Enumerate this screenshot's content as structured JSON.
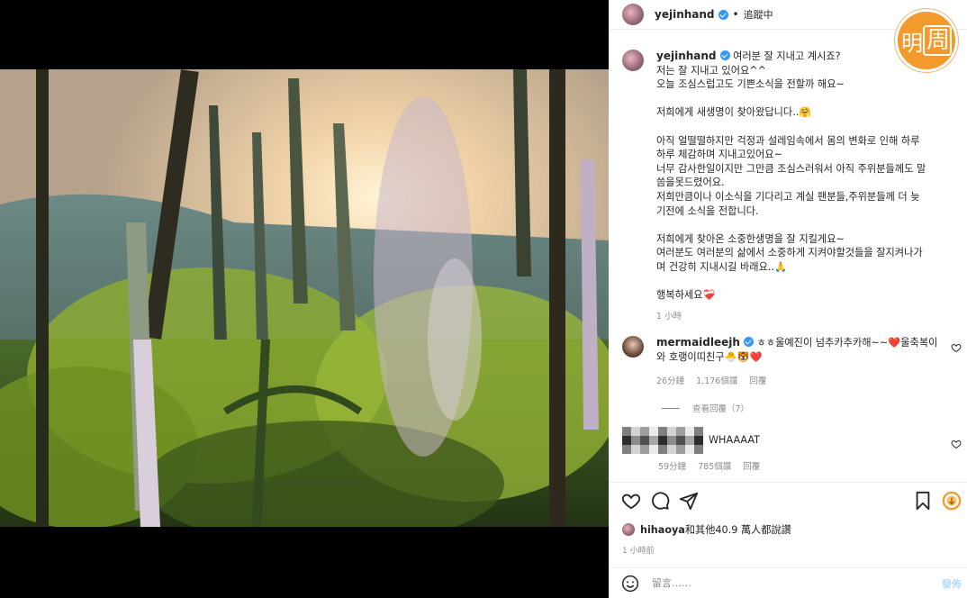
{
  "header": {
    "username": "yejinhand",
    "follow_status": "追蹤中",
    "separator": "•"
  },
  "badge": {
    "char1": "明",
    "char2": "周",
    "color": "#f39a2c"
  },
  "caption": {
    "username": "yejinhand",
    "lines": [
      "여러분 잘 지내고 계시죠?",
      "저는 잘 지내고 있어요^^",
      "오늘 조심스럽고도 기쁜소식을 전할까 해요~",
      "",
      "저희에게 새생명이 찾아왔답니다..🤗",
      "",
      "아직 얼떨떨하지만 걱정과 설레임속에서 몸의 변화로 인해 하루",
      "하루 체감하며 지내고있어요~",
      "너무 감사한일이지만 그만큼 조심스러워서 아직 주위분들께도 말",
      "씀을못드렸어요.",
      "저희만큼이나 이소식을 기다리고 계실 팬분들,주위분들께 더 늦",
      "기전에 소식을 전합니다.",
      "",
      "저희에게 찾아온 소중한생명을 잘 지킬게요~",
      "여러분도 여러분의 삶에서 소중하게 지켜야할것들을 잘지켜나가",
      "며 건강히 지내시길 바래요..🙏",
      "",
      "행복하세요❤️‍🩹"
    ],
    "time": "1 小時"
  },
  "comments": [
    {
      "username": "mermaidleejh",
      "text_line1": "ㅎㅎ울예진이 넘추카추카해~~❤️울축복이",
      "text_line2": "와 호랭이띠친구🐣🐯❤️",
      "time": "26分鐘",
      "likes": "1,176個讚",
      "reply": "回覆",
      "view_replies": "查看回覆（7）"
    },
    {
      "username": "",
      "text": "WHAAAAT",
      "time": "59分鐘",
      "likes": "785個讚",
      "reply": "回覆"
    }
  ],
  "actions": {
    "icons": [
      "heart-icon",
      "comment-icon",
      "share-icon",
      "bookmark-icon"
    ]
  },
  "likes": {
    "first_user": "hihaoya",
    "rest": "和其他40.9 萬人都說讚"
  },
  "post_time": "1 小時前",
  "add_comment": {
    "placeholder": "留言……",
    "post_label": "發佈"
  }
}
